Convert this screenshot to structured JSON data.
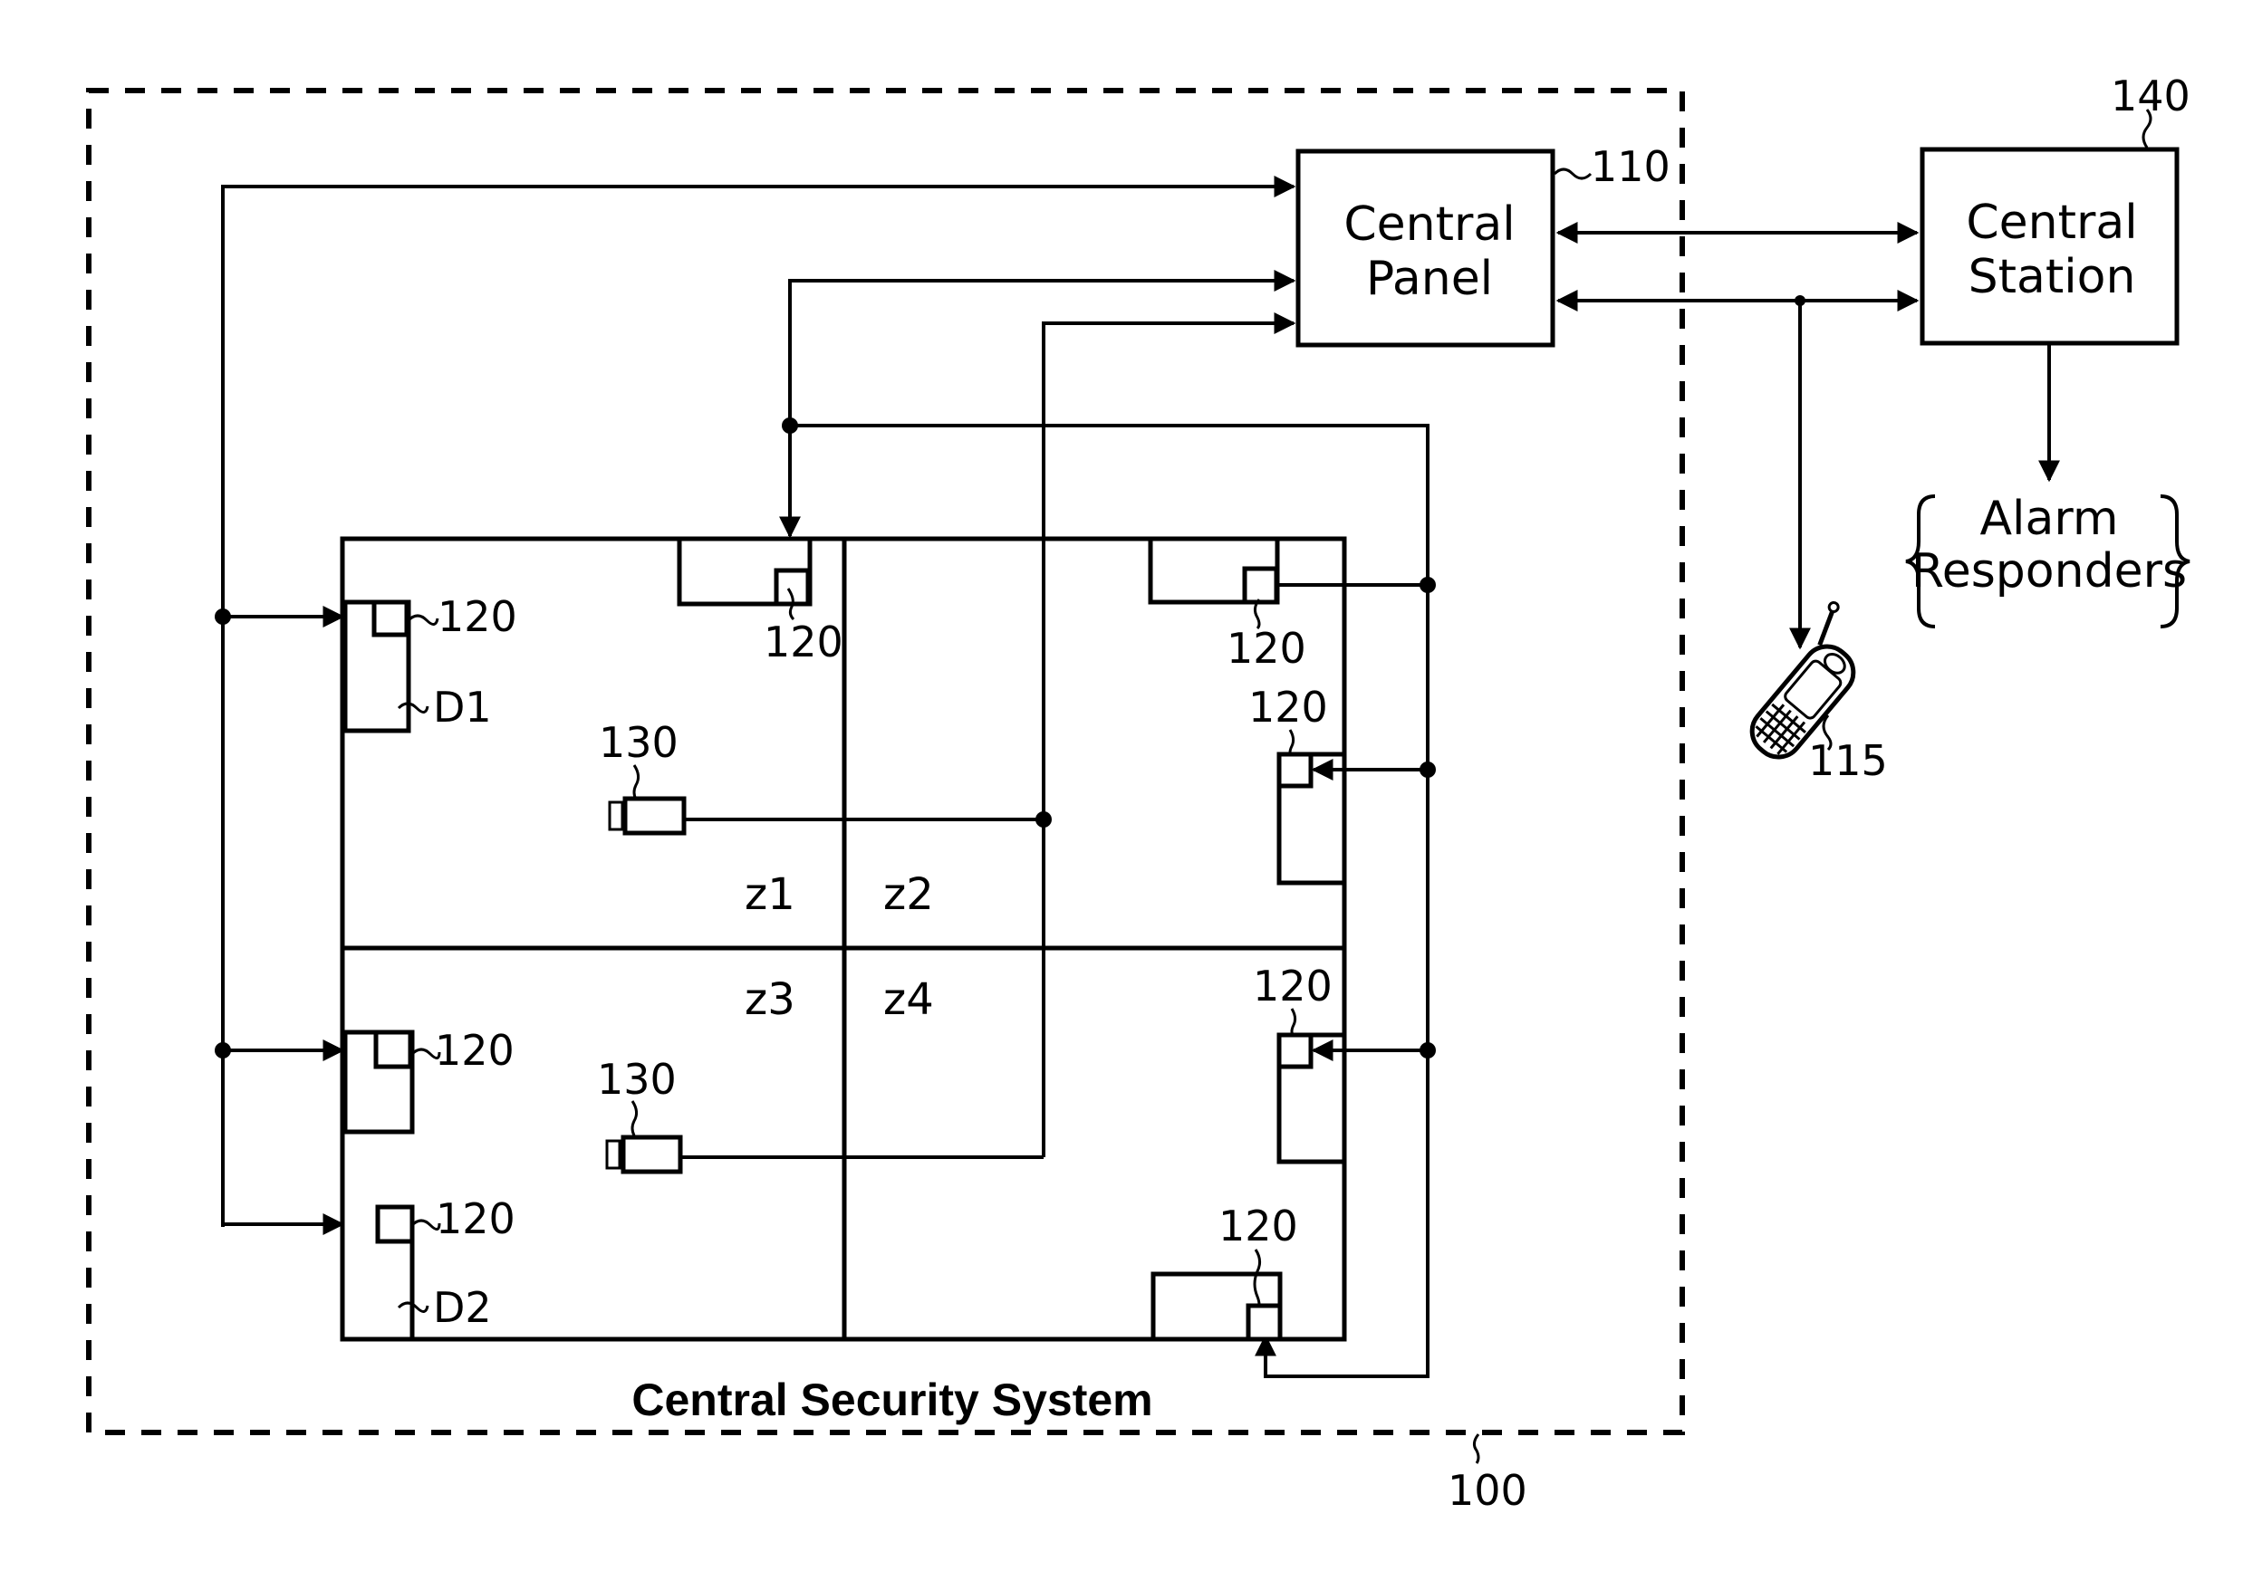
{
  "figure": {
    "system_label": "Central Security System",
    "system_ref": "100"
  },
  "central_panel": {
    "line1": "Central",
    "line2": "Panel",
    "ref": "110"
  },
  "central_station": {
    "line1": "Central",
    "line2": "Station",
    "ref": "140"
  },
  "alarm_responders": {
    "line1": "Alarm",
    "line2": "Responders"
  },
  "mobile_device": {
    "ref": "115",
    "icon": "mobile-phone-icon"
  },
  "zones": [
    "z1",
    "z2",
    "z3",
    "z4"
  ],
  "doors": {
    "d1": "D1",
    "d2": "D2"
  },
  "sensors": {
    "ref": "120",
    "count": 8
  },
  "cameras": {
    "ref": "130",
    "count": 2
  }
}
